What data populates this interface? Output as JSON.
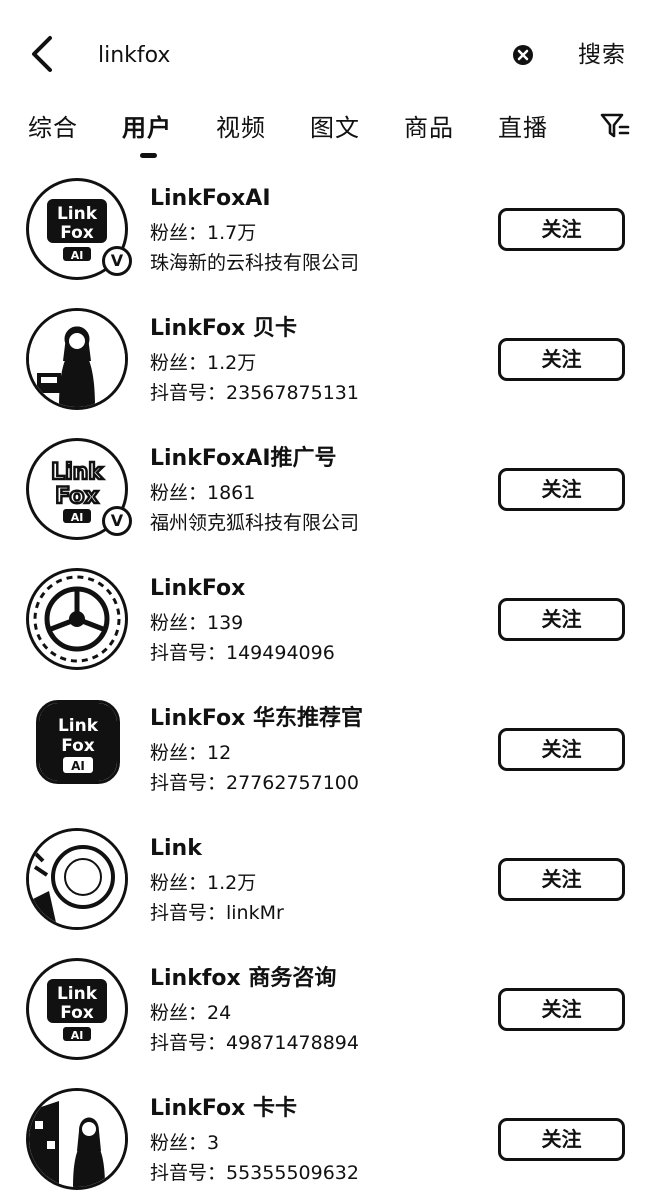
{
  "search": {
    "query": "linkfox",
    "submit_label": "搜索"
  },
  "tabs": [
    {
      "label": "综合"
    },
    {
      "label": "用户",
      "active": true
    },
    {
      "label": "视频"
    },
    {
      "label": "图文"
    },
    {
      "label": "商品"
    },
    {
      "label": "直播"
    }
  ],
  "icons": {
    "back": "chevron-left-icon",
    "clear": "clear-circle-icon",
    "filter": "filter-icon",
    "verified": "verified-v-icon"
  },
  "users": [
    {
      "name": "LinkFoxAI",
      "fans": "粉丝：1.7万",
      "meta": "珠海新的云科技有限公司",
      "follow_label": "关注",
      "verified": true,
      "avatar": "linkfox-ai-logo"
    },
    {
      "name": "LinkFox 贝卡",
      "fans": "粉丝：1.2万",
      "meta": "抖音号：23567875131",
      "follow_label": "关注",
      "verified": false,
      "avatar": "woman-photo"
    },
    {
      "name": "LinkFoxAI推广号",
      "fans": "粉丝：1861",
      "meta": "福州领克狐科技有限公司",
      "follow_label": "关注",
      "verified": true,
      "avatar": "linkfox-ai-logo"
    },
    {
      "name": "LinkFox",
      "fans": "粉丝：139",
      "meta": "抖音号：149494096",
      "follow_label": "关注",
      "verified": false,
      "avatar": "wheel-emblem"
    },
    {
      "name": "LinkFox 华东推荐官",
      "fans": "粉丝：12",
      "meta": "抖音号：27762757100",
      "follow_label": "关注",
      "verified": false,
      "avatar": "linkfox-ai-square-logo"
    },
    {
      "name": "Link",
      "fans": "粉丝：1.2万",
      "meta": "抖音号：linkMr",
      "follow_label": "关注",
      "verified": false,
      "avatar": "abstract-photo"
    },
    {
      "name": "Linkfox 商务咨询",
      "fans": "粉丝：24",
      "meta": "抖音号：49871478894",
      "follow_label": "关注",
      "verified": false,
      "avatar": "linkfox-ai-logo"
    },
    {
      "name": "LinkFox 卡卡",
      "fans": "粉丝：3",
      "meta": "抖音号：55355509632",
      "follow_label": "关注",
      "verified": false,
      "avatar": "woman-photo"
    }
  ]
}
